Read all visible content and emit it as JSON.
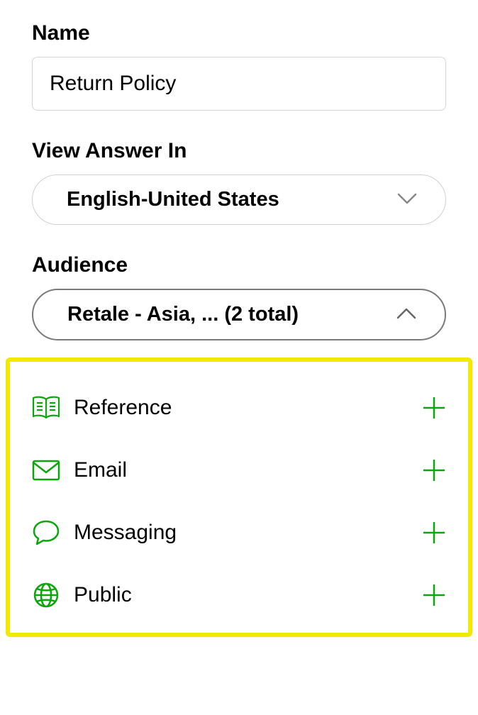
{
  "nameField": {
    "label": "Name",
    "value": "Return Policy"
  },
  "viewAnswerField": {
    "label": "View Answer In",
    "value": "English-United States"
  },
  "audienceField": {
    "label": "Audience",
    "value": "Retale - Asia, ... (2 total)"
  },
  "channels": [
    {
      "key": "reference",
      "label": "Reference",
      "icon": "book"
    },
    {
      "key": "email",
      "label": "Email",
      "icon": "mail"
    },
    {
      "key": "messaging",
      "label": "Messaging",
      "icon": "chat"
    },
    {
      "key": "public",
      "label": "Public",
      "icon": "globe"
    }
  ],
  "colors": {
    "accent": "#0aa60a",
    "highlight": "#f2e900"
  }
}
